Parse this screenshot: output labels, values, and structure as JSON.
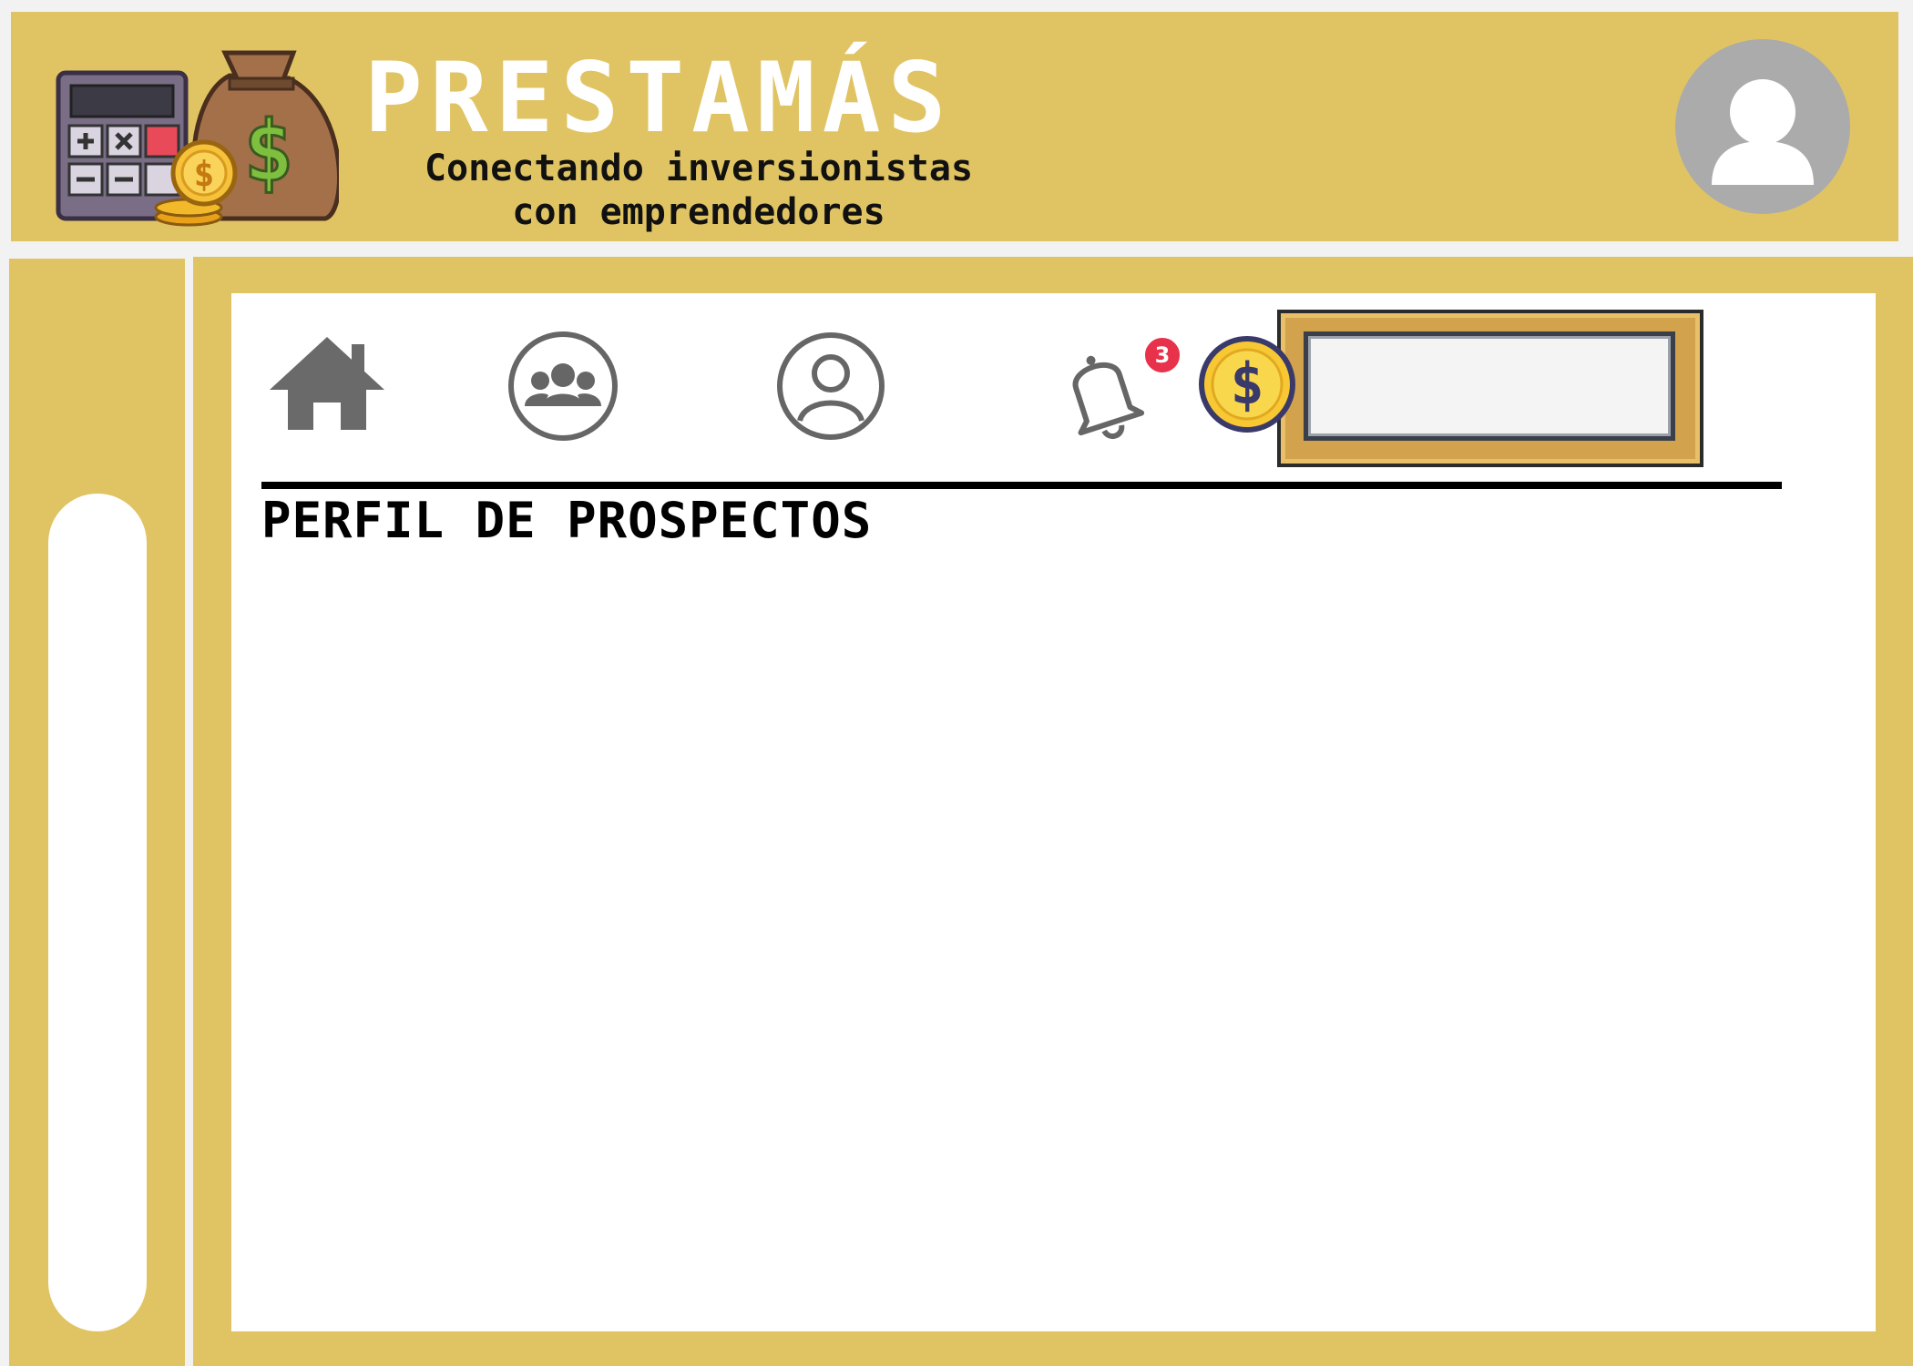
{
  "brand": {
    "title": "PRESTAMÁS",
    "subtitle_line1": "Conectando inversionistas",
    "subtitle_line2": "con emprendedores",
    "logo_icon": "calculator-money-bag-icon"
  },
  "header": {
    "avatar_icon": "user-avatar-icon"
  },
  "nav": {
    "items": [
      {
        "icon": "home-icon"
      },
      {
        "icon": "group-icon"
      },
      {
        "icon": "profile-icon"
      },
      {
        "icon": "bell-icon"
      }
    ],
    "notification_count": "3",
    "coin_icon": "dollar-coin-icon",
    "balance_value": ""
  },
  "main": {
    "section_title": "PERFIL DE PROSPECTOS"
  },
  "colors": {
    "accent": "#e0c464",
    "badge": "#e8314a",
    "icon_gray": "#6a6a6a"
  }
}
